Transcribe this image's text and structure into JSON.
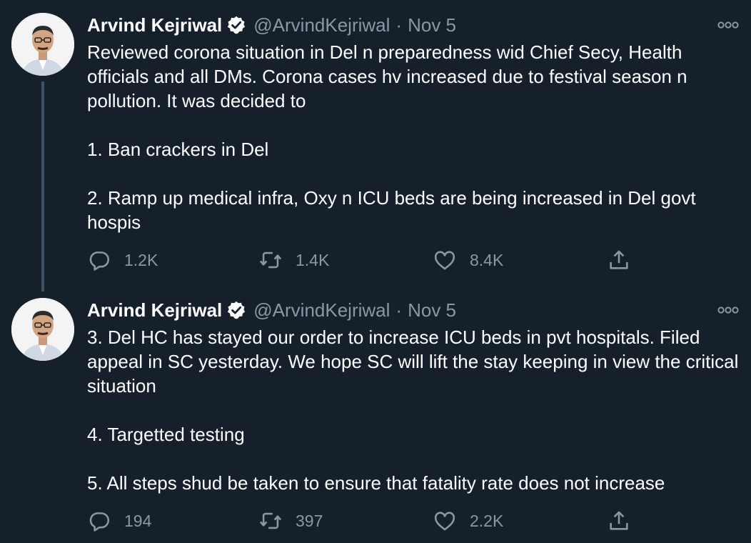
{
  "tweets": [
    {
      "author": "Arvind Kejriwal",
      "handle": "@ArvindKejriwal",
      "separator": "·",
      "date": "Nov 5",
      "paragraphs": [
        "Reviewed corona situation in Del n preparedness wid Chief Secy, Health officials and all DMs. Corona cases hv increased due to festival season n pollution. It was decided to",
        "1. Ban crackers in Del",
        "2. Ramp up medical infra, Oxy n ICU beds are being increased in Del govt hospis"
      ],
      "replies": "1.2K",
      "retweets": "1.4K",
      "likes": "8.4K"
    },
    {
      "author": "Arvind Kejriwal",
      "handle": "@ArvindKejriwal",
      "separator": "·",
      "date": "Nov 5",
      "paragraphs": [
        "3. Del HC has stayed our order to increase ICU beds in pvt hospitals. Filed appeal in SC yesterday. We hope SC will lift the stay keeping in view the critical situation",
        "4. Targetted testing",
        "5. All steps shud be taken to ensure that fatality rate does not increase"
      ],
      "replies": "194",
      "retweets": "397",
      "likes": "2.2K"
    }
  ],
  "icons": {
    "verified": "verified-badge-icon",
    "more": "more-options-icon",
    "reply": "reply-icon",
    "retweet": "retweet-icon",
    "like": "like-icon",
    "share": "share-icon"
  },
  "colors": {
    "background": "#15202b",
    "text": "#ffffff",
    "secondary": "#8899a6",
    "thread_line": "#3d5466"
  }
}
